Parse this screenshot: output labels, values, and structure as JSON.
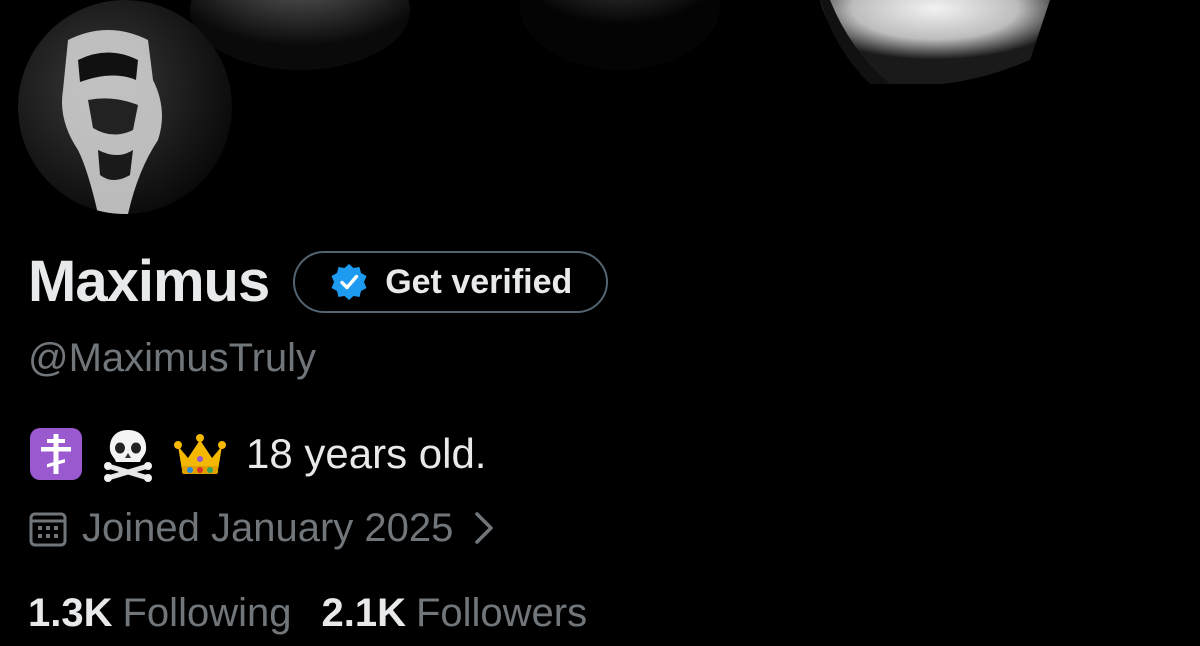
{
  "profile": {
    "display_name": "Maximus",
    "handle": "@MaximusTruly",
    "bio": {
      "emojis": [
        "orthodox-cross-emoji",
        "skull-and-crossbones-emoji",
        "crown-emoji"
      ],
      "text": "18 years old."
    },
    "joined": "Joined January 2025",
    "stats": {
      "following_count": "1.3K",
      "following_label": "Following",
      "followers_count": "2.1K",
      "followers_label": "Followers"
    }
  },
  "actions": {
    "get_verified_label": "Get verified"
  },
  "colors": {
    "background": "#000000",
    "primary_text": "#e7e9ea",
    "secondary_text": "#71767b",
    "verified_blue": "#1d9bf0",
    "button_border": "#536471"
  },
  "icons": {
    "verified_badge": "verified-badge-icon",
    "calendar": "calendar-icon",
    "chevron": "chevron-right-icon"
  }
}
